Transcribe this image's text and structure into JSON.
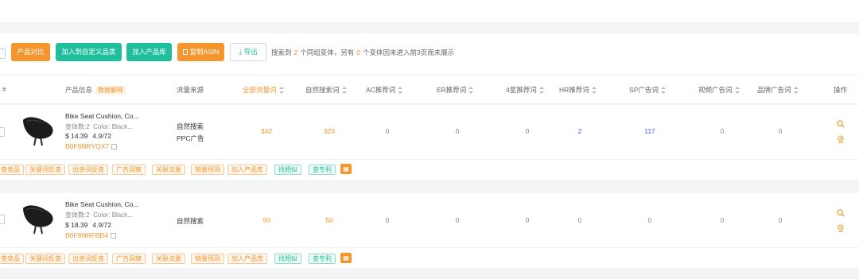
{
  "toolbar": {
    "compare_label": "产品对比",
    "add_custom_label": "加入到自定义品类",
    "add_library_label": "加入产品库",
    "copy_asin_label": "复制ASIN",
    "export_label": "导出",
    "info": {
      "prefix": "搜索到",
      "count1": "2",
      "mid": "个同组变体，另有",
      "count2": "0",
      "suffix": "个变体因未进入前3页而未展示"
    }
  },
  "columns": {
    "index": "#",
    "product_info": "产品信息",
    "data_explain": "数据解释",
    "traffic_source": "流量来源",
    "all_traffic": "全部流量词",
    "organic": "自然搜索词",
    "ac": "AC推荐词",
    "er": "ER推荐词",
    "star4": "4星推荐词",
    "hr": "HR推荐词",
    "sp": "SP广告词",
    "video": "视频广告词",
    "brand": "品牌广告词",
    "action": "操作"
  },
  "rows": [
    {
      "title": "Bike Seat Cushion, Co...",
      "variants": "变体数:2",
      "color": "Color: Black...",
      "price": "$ 14.39",
      "rating": "4.9/72",
      "asin": "B0F9NRYQX7",
      "sources": [
        "自然搜索",
        "PPC广告"
      ],
      "all_traffic": "342",
      "organic": "323",
      "ac": "0",
      "er": "0",
      "star4": "0",
      "hr": "2",
      "sp": "117",
      "video": "0",
      "brand": "0"
    },
    {
      "title": "Bike Seat Cushion, Co...",
      "variants": "变体数:2",
      "color": "Color: Black...",
      "price": "$ 18.39",
      "rating": "4.9/72",
      "asin": "B0F9NRFBB4",
      "sources": [
        "自然搜索"
      ],
      "all_traffic": "50",
      "organic": "50",
      "ac": "0",
      "er": "0",
      "star4": "0",
      "hr": "0",
      "sp": "0",
      "video": "0",
      "brand": "0"
    }
  ],
  "row_tags": [
    "查竞品",
    "关键词反查",
    "出单词反查",
    "广告洞察",
    "关联流量",
    "销量预测",
    "加入产品库",
    "找相似",
    "查专利"
  ],
  "colors": {
    "accent_orange": "#f5952e",
    "accent_teal": "#1fbe9c",
    "link_blue": "#3b63e6"
  }
}
